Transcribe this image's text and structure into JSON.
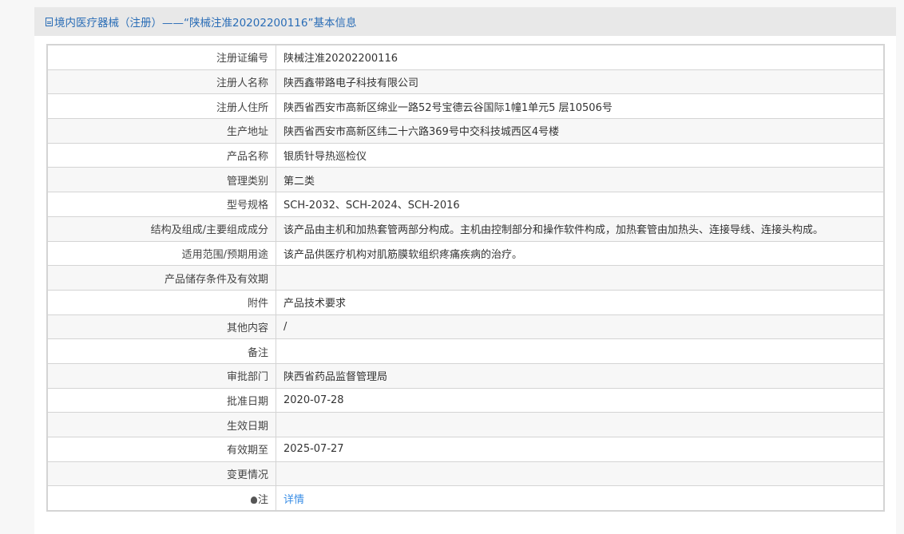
{
  "header": {
    "title": "境内医疗器械（注册）——“陕械注准20202200116”基本信息"
  },
  "rows": [
    {
      "label": "注册证编号",
      "value": "陕械注准20202200116"
    },
    {
      "label": "注册人名称",
      "value": "陕西鑫带路电子科技有限公司"
    },
    {
      "label": "注册人住所",
      "value": "陕西省西安市高新区绵业一路52号宝德云谷国际1幢1单元5 层10506号"
    },
    {
      "label": "生产地址",
      "value": "陕西省西安市高新区纬二十六路369号中交科技城西区4号楼"
    },
    {
      "label": "产品名称",
      "value": "银质针导热巡检仪"
    },
    {
      "label": "管理类别",
      "value": "第二类"
    },
    {
      "label": "型号规格",
      "value": "SCH-2032、SCH-2024、SCH-2016"
    },
    {
      "label": "结构及组成/主要组成成分",
      "value": "该产品由主机和加热套管两部分构成。主机由控制部分和操作软件构成，加热套管由加热头、连接导线、连接头构成。"
    },
    {
      "label": "适用范围/预期用途",
      "value": "该产品供医疗机构对肌筋膜软组织疼痛疾病的治疗。"
    },
    {
      "label": "产品储存条件及有效期",
      "value": ""
    },
    {
      "label": "附件",
      "value": "产品技术要求"
    },
    {
      "label": "其他内容",
      "value": "/"
    },
    {
      "label": "备注",
      "value": ""
    },
    {
      "label": "审批部门",
      "value": "陕西省药品监督管理局"
    },
    {
      "label": "批准日期",
      "value": "2020-07-28"
    },
    {
      "label": "生效日期",
      "value": ""
    },
    {
      "label": "有效期至",
      "value": "2025-07-27"
    },
    {
      "label": "变更情况",
      "value": ""
    }
  ],
  "note": {
    "label": "注",
    "link": "详情",
    "icon": "lightbulb-icon"
  }
}
